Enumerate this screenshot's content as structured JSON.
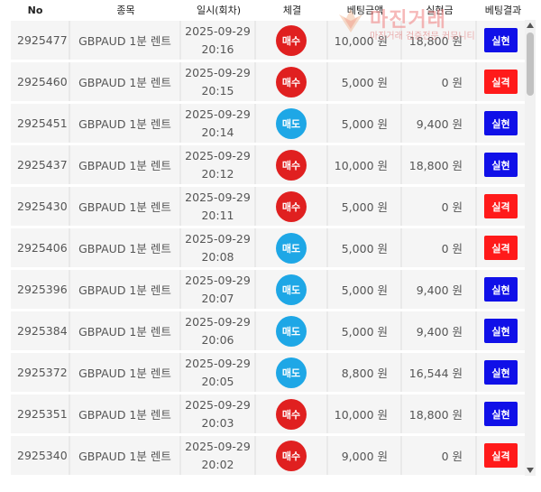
{
  "header": {
    "no": "No",
    "item": "종목",
    "date": "일시(회차)",
    "exec": "체결",
    "bet": "베팅금액",
    "win": "실현금",
    "result": "베팅결과"
  },
  "watermark": {
    "title": "마진거래",
    "subtitle": "마진거래 검증전문 커뮤니티"
  },
  "colors": {
    "buy": "#e02020",
    "sell": "#1ea7e6",
    "win": "#1010e8",
    "loss": "#ff1a1a"
  },
  "rows": [
    {
      "no": "2925477",
      "item": "GBPAUD 1분 렌트",
      "date": "2025-09-29",
      "time": "20:16",
      "exec": "매수",
      "bet": "10,000 원",
      "win": "18,800 원",
      "result": "실현"
    },
    {
      "no": "2925460",
      "item": "GBPAUD 1분 렌트",
      "date": "2025-09-29",
      "time": "20:15",
      "exec": "매수",
      "bet": "5,000 원",
      "win": "0 원",
      "result": "실격"
    },
    {
      "no": "2925451",
      "item": "GBPAUD 1분 렌트",
      "date": "2025-09-29",
      "time": "20:14",
      "exec": "매도",
      "bet": "5,000 원",
      "win": "9,400 원",
      "result": "실현"
    },
    {
      "no": "2925437",
      "item": "GBPAUD 1분 렌트",
      "date": "2025-09-29",
      "time": "20:12",
      "exec": "매수",
      "bet": "10,000 원",
      "win": "18,800 원",
      "result": "실현"
    },
    {
      "no": "2925430",
      "item": "GBPAUD 1분 렌트",
      "date": "2025-09-29",
      "time": "20:11",
      "exec": "매수",
      "bet": "5,000 원",
      "win": "0 원",
      "result": "실격"
    },
    {
      "no": "2925406",
      "item": "GBPAUD 1분 렌트",
      "date": "2025-09-29",
      "time": "20:08",
      "exec": "매도",
      "bet": "5,000 원",
      "win": "0 원",
      "result": "실격"
    },
    {
      "no": "2925396",
      "item": "GBPAUD 1분 렌트",
      "date": "2025-09-29",
      "time": "20:07",
      "exec": "매도",
      "bet": "5,000 원",
      "win": "9,400 원",
      "result": "실현"
    },
    {
      "no": "2925384",
      "item": "GBPAUD 1분 렌트",
      "date": "2025-09-29",
      "time": "20:06",
      "exec": "매도",
      "bet": "5,000 원",
      "win": "9,400 원",
      "result": "실현"
    },
    {
      "no": "2925372",
      "item": "GBPAUD 1분 렌트",
      "date": "2025-09-29",
      "time": "20:05",
      "exec": "매도",
      "bet": "8,800 원",
      "win": "16,544 원",
      "result": "실현"
    },
    {
      "no": "2925351",
      "item": "GBPAUD 1분 렌트",
      "date": "2025-09-29",
      "time": "20:03",
      "exec": "매수",
      "bet": "10,000 원",
      "win": "18,800 원",
      "result": "실현"
    },
    {
      "no": "2925340",
      "item": "GBPAUD 1분 렌트",
      "date": "2025-09-29",
      "time": "20:02",
      "exec": "매수",
      "bet": "9,000 원",
      "win": "0 원",
      "result": "실격"
    }
  ]
}
